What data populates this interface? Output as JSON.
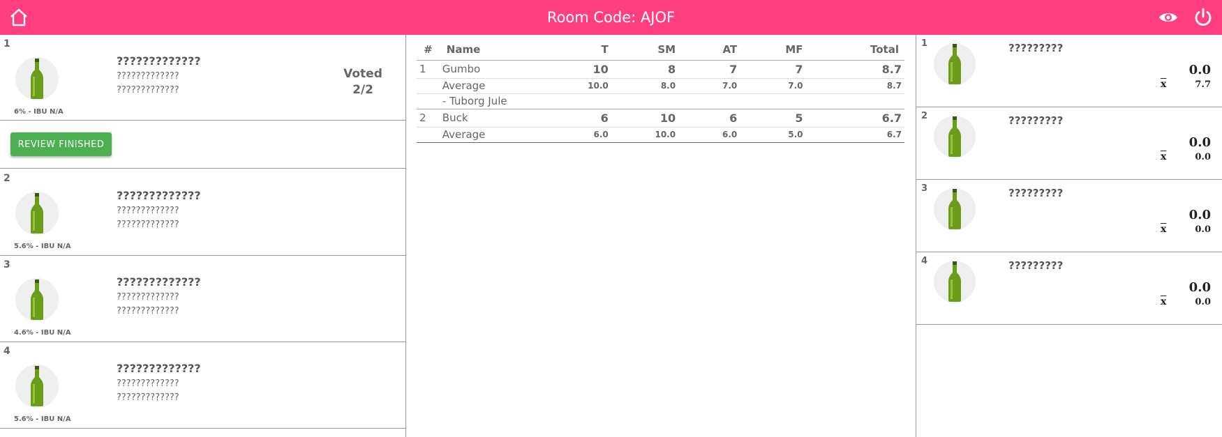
{
  "header": {
    "title": "Room Code: AJOF",
    "bg_color": "#ff3f7f",
    "home_icon": "home-icon",
    "eye_icon": "eye-icon",
    "power_icon": "power-icon"
  },
  "left": {
    "voted_label": "Voted",
    "voted_count": "2/2",
    "finish_button": "REVIEW FINISHED",
    "beers": [
      {
        "num": "1",
        "name": "?????????????",
        "line1": "?????????????",
        "line2": "?????????????",
        "abv": "6% - IBU N/A"
      },
      {
        "num": "2",
        "name": "?????????????",
        "line1": "?????????????",
        "line2": "?????????????",
        "abv": "5.6% - IBU N/A"
      },
      {
        "num": "3",
        "name": "?????????????",
        "line1": "?????????????",
        "line2": "?????????????",
        "abv": "4.6% - IBU N/A"
      },
      {
        "num": "4",
        "name": "?????????????",
        "line1": "?????????????",
        "line2": "?????????????",
        "abv": "5.6% - IBU N/A"
      }
    ]
  },
  "table": {
    "headers": [
      "#",
      "Name",
      "T",
      "SM",
      "AT",
      "MF",
      "Total"
    ],
    "rows": [
      {
        "num": "1",
        "name": "Gumbo",
        "t": "10",
        "sm": "8",
        "at": "7",
        "mf": "7",
        "total": "8.7",
        "avg_label": "Average",
        "avg_t": "10.0",
        "avg_sm": "8.0",
        "avg_at": "7.0",
        "avg_mf": "7.0",
        "avg_total": "8.7",
        "sub": "- Tuborg Jule"
      },
      {
        "num": "2",
        "name": "Buck",
        "t": "6",
        "sm": "10",
        "at": "6",
        "mf": "5",
        "total": "6.7",
        "avg_label": "Average",
        "avg_t": "6.0",
        "avg_sm": "10.0",
        "avg_at": "6.0",
        "avg_mf": "5.0",
        "avg_total": "6.7"
      }
    ]
  },
  "right": {
    "xbar_symbol": "x",
    "beers": [
      {
        "num": "1",
        "name": "?????????",
        "score": "0.0",
        "avg": "7.7"
      },
      {
        "num": "2",
        "name": "?????????",
        "score": "0.0",
        "avg": "0.0"
      },
      {
        "num": "3",
        "name": "?????????",
        "score": "0.0",
        "avg": "0.0"
      },
      {
        "num": "4",
        "name": "?????????",
        "score": "0.0",
        "avg": "0.0"
      }
    ]
  }
}
